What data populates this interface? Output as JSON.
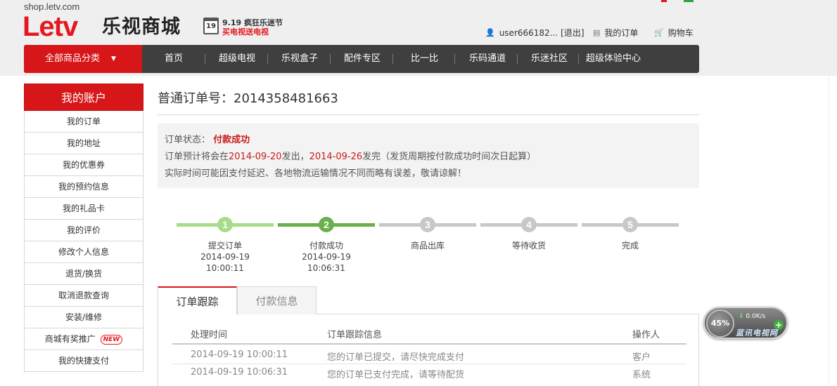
{
  "header": {
    "domain": "shop.letv.com",
    "logo_latin": "Letv",
    "logo_cn": "乐视商城",
    "promo": {
      "calendar_day": "19",
      "line1": "9.19 疯狂乐迷节",
      "line2": "买电视送电视"
    },
    "user": "user666182...",
    "logout": "[退出]",
    "my_orders": "我的订单",
    "cart": "购物车"
  },
  "nav": {
    "all_categories": "全部商品分类",
    "items": [
      "首页",
      "超级电视",
      "乐视盒子",
      "配件专区",
      "比一比",
      "乐码通道",
      "乐迷社区",
      "超级体验中心"
    ]
  },
  "sidebar": {
    "title": "我的账户",
    "items": [
      "我的订单",
      "我的地址",
      "我的优惠券",
      "我的预约信息",
      "我的礼品卡",
      "我的评价",
      "修改个人信息",
      "退货/换货",
      "取消退款查询",
      "安装/维修",
      "商城有奖推广",
      "我的快捷支付"
    ],
    "new_badge": "NEW"
  },
  "order": {
    "title": "普通订单号：2014358481663",
    "status_label": "订单状态：",
    "status_value": "付款成功",
    "ship_prefix": "订单预计将会在",
    "ship_date1": "2014-09-20",
    "ship_mid": "发出，",
    "ship_date2": "2014-09-26",
    "ship_suffix": "发完（发货周期按付款成功时间次日起算）",
    "notice": "实际时间可能因支付延迟、各地物流运输情况不同而略有误差，敬请谅解！"
  },
  "steps": [
    {
      "num": "1",
      "label": "提交订单",
      "date": "2014-09-19",
      "time": "10:00:11"
    },
    {
      "num": "2",
      "label": "付款成功",
      "date": "2014-09-19",
      "time": "10:06:31"
    },
    {
      "num": "3",
      "label": "商品出库",
      "date": "",
      "time": ""
    },
    {
      "num": "4",
      "label": "等待收货",
      "date": "",
      "time": ""
    },
    {
      "num": "5",
      "label": "完成",
      "date": "",
      "time": ""
    }
  ],
  "tabs": {
    "tracking": "订单跟踪",
    "payment": "付款信息"
  },
  "tracking": {
    "headers": {
      "time": "处理时间",
      "info": "订单跟踪信息",
      "operator": "操作人"
    },
    "rows": [
      {
        "time": "2014-09-19 10:00:11",
        "info": "您的订单已提交，请尽快完成支付",
        "operator": "客户"
      },
      {
        "time": "2014-09-19 10:06:31",
        "info": "您的订单已支付完成，请等待配货",
        "operator": "系统"
      }
    ]
  },
  "speed_widget": {
    "percent": "45%",
    "rate": "0.0K/s",
    "plus": "+",
    "brand": "蓝讯电视网"
  },
  "colors": {
    "brand_red": "#d61618",
    "nav_dark": "#3f3f3f",
    "step_done_light": "#a6dc8a",
    "step_done": "#6ab04c",
    "step_pending": "#c8c8c8"
  }
}
